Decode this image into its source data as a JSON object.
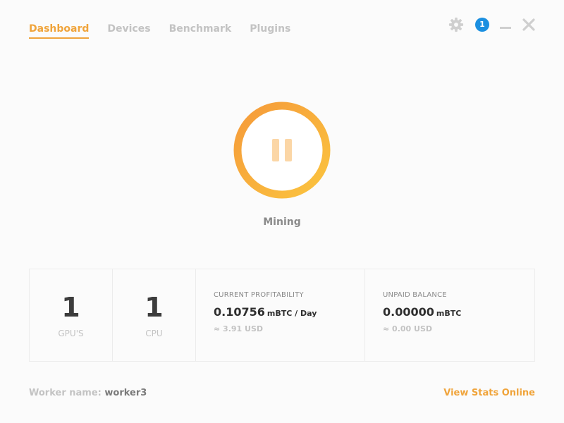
{
  "nav": {
    "tabs": [
      {
        "label": "Dashboard",
        "active": true
      },
      {
        "label": "Devices",
        "active": false
      },
      {
        "label": "Benchmark",
        "active": false
      },
      {
        "label": "Plugins",
        "active": false
      }
    ]
  },
  "window_controls": {
    "settings_icon": "gear-icon",
    "notification_count": "1",
    "minimize_icon": "minimize-icon",
    "close_icon": "close-icon"
  },
  "mining": {
    "status_label": "Mining",
    "button_icon": "pause-icon"
  },
  "stats": {
    "gpus": {
      "count": "1",
      "label": "GPU'S"
    },
    "cpus": {
      "count": "1",
      "label": "CPU"
    },
    "profitability": {
      "title": "CURRENT PROFITABILITY",
      "value": "0.10756",
      "unit": "mBTC / Day",
      "usd": "≈ 3.91 USD"
    },
    "balance": {
      "title": "UNPAID BALANCE",
      "value": "0.00000",
      "unit": "mBTC",
      "usd": "≈ 0.00 USD"
    }
  },
  "footer": {
    "worker_label": "Worker name:",
    "worker_value": "worker3",
    "view_stats_label": "View Stats Online"
  },
  "colors": {
    "accent": "#f0a43b",
    "badge": "#1b8fe0",
    "ring_start": "#f59a3a",
    "ring_end": "#fbc43f",
    "pause_icon": "#fbd6a6"
  }
}
